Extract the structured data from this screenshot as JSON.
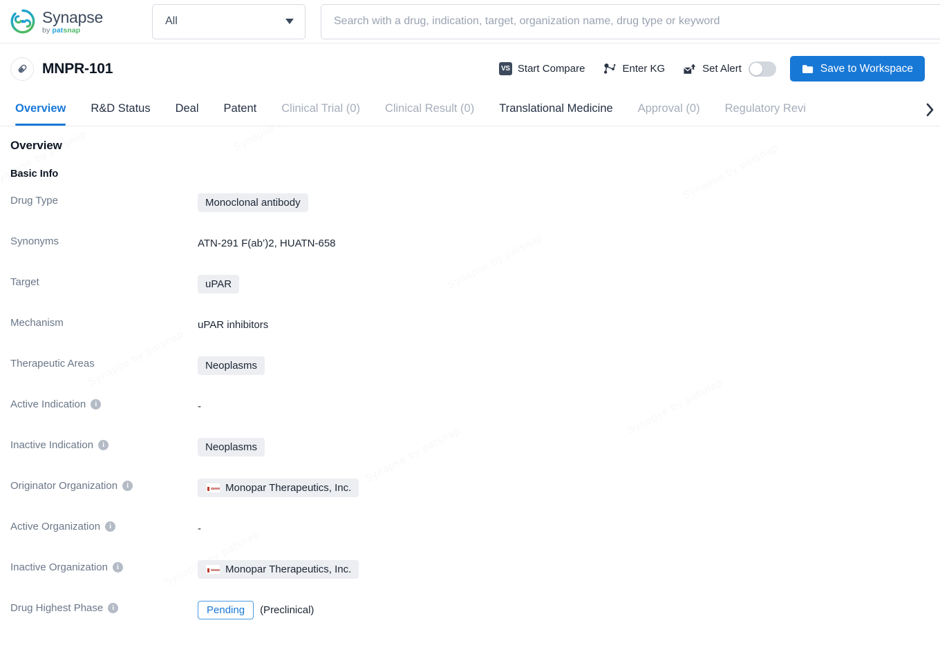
{
  "brand": {
    "name": "Synapse",
    "by": "by ",
    "pat": "pat",
    "snap": "snap",
    "logo_icon": "synapse-swirl-logo",
    "colors": {
      "blue": "#2aa3d8",
      "green": "#52b96b",
      "accent": "#1878d6"
    }
  },
  "search": {
    "scope_value": "All",
    "scope_caret_icon": "chevron-down-icon",
    "placeholder": "Search with a drug, indication, target, organization name, drug type or keyword",
    "value": ""
  },
  "drug_header": {
    "icon": "pill-capsule-icon",
    "title": "MNPR-101",
    "actions": [
      {
        "id": "start-compare",
        "label": "Start Compare",
        "icon": "vs-icon",
        "badge_text": "VS"
      },
      {
        "id": "enter-kg",
        "label": "Enter KG",
        "icon": "knowledge-graph-icon"
      },
      {
        "id": "set-alert",
        "label": "Set Alert",
        "icon": "alert-envelope-icon",
        "toggle_on": false
      }
    ],
    "save_button": {
      "label": "Save to Workspace",
      "icon": "folder-icon"
    }
  },
  "tabs": [
    {
      "label": "Overview",
      "state": "active"
    },
    {
      "label": "R&D Status",
      "state": "normal"
    },
    {
      "label": "Deal",
      "state": "normal"
    },
    {
      "label": "Patent",
      "state": "normal"
    },
    {
      "label": "Clinical Trial (0)",
      "state": "muted"
    },
    {
      "label": "Clinical Result (0)",
      "state": "muted"
    },
    {
      "label": "Translational Medicine",
      "state": "normal"
    },
    {
      "label": "Approval (0)",
      "state": "muted"
    },
    {
      "label": "Regulatory Revi",
      "state": "muted"
    }
  ],
  "tabs_next_icon": "chevron-right-icon",
  "overview": {
    "heading": "Overview",
    "basic_info_heading": "Basic Info",
    "rows": [
      {
        "label": "Drug Type",
        "has_info_icon": false,
        "type": "chip",
        "values": [
          "Monoclonal antibody"
        ]
      },
      {
        "label": "Synonyms",
        "has_info_icon": false,
        "type": "plain",
        "text": "ATN-291 F(ab’)2,  HUATN-658"
      },
      {
        "label": "Target",
        "has_info_icon": false,
        "type": "chip",
        "values": [
          "uPAR"
        ]
      },
      {
        "label": "Mechanism",
        "has_info_icon": false,
        "type": "plain",
        "text": "uPAR inhibitors"
      },
      {
        "label": "Therapeutic Areas",
        "has_info_icon": false,
        "type": "chip",
        "values": [
          "Neoplasms"
        ]
      },
      {
        "label": "Active Indication",
        "has_info_icon": true,
        "type": "dash",
        "text": "-"
      },
      {
        "label": "Inactive Indication",
        "has_info_icon": true,
        "type": "chip",
        "values": [
          "Neoplasms"
        ]
      },
      {
        "label": "Originator Organization",
        "has_info_icon": true,
        "type": "org-chip",
        "values": [
          "Monopar Therapeutics, Inc."
        ]
      },
      {
        "label": "Active Organization",
        "has_info_icon": true,
        "type": "dash",
        "text": "-"
      },
      {
        "label": "Inactive Organization",
        "has_info_icon": true,
        "type": "org-chip",
        "values": [
          "Monopar Therapeutics, Inc."
        ]
      },
      {
        "label": "Drug Highest Phase",
        "has_info_icon": true,
        "type": "phase",
        "badge": "Pending",
        "note": "(Preclinical)"
      }
    ],
    "info_icon_glyph": "i"
  },
  "watermark_text": "Synapse by patsnap"
}
